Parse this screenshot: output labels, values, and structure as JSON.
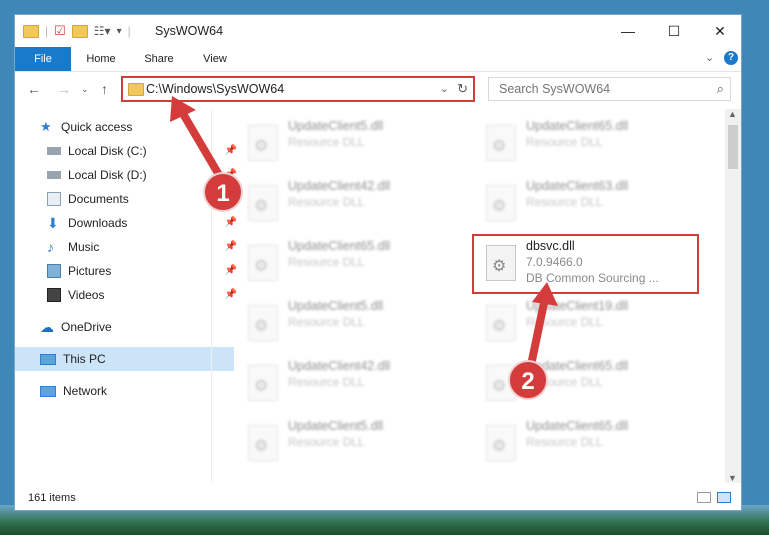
{
  "window": {
    "title": "SysWOW64",
    "controls": {
      "minimize": "—",
      "maximize": "☐",
      "close": "✕"
    }
  },
  "ribbon": {
    "tabs": [
      "File",
      "Home",
      "Share",
      "View"
    ],
    "expand_icon": "chevron-down-icon",
    "help": "?"
  },
  "address": {
    "path": "C:\\Windows\\SysWOW64",
    "search_placeholder": "Search SysWOW64"
  },
  "sidebar": {
    "items": [
      {
        "label": "Quick access",
        "icon": "star-icon",
        "pinned": false
      },
      {
        "label": "Local Disk (C:)",
        "icon": "drive-icon",
        "pinned": true
      },
      {
        "label": "Local Disk (D:)",
        "icon": "drive-icon",
        "pinned": true
      },
      {
        "label": "Documents",
        "icon": "documents-icon",
        "pinned": true
      },
      {
        "label": "Downloads",
        "icon": "download-icon",
        "pinned": true
      },
      {
        "label": "Music",
        "icon": "music-icon",
        "pinned": true
      },
      {
        "label": "Pictures",
        "icon": "pictures-icon",
        "pinned": true
      },
      {
        "label": "Videos",
        "icon": "videos-icon",
        "pinned": true
      },
      {
        "label": "OneDrive",
        "icon": "cloud-icon",
        "pinned": false
      },
      {
        "label": "This PC",
        "icon": "computer-icon",
        "pinned": false,
        "selected": true
      },
      {
        "label": "Network",
        "icon": "network-icon",
        "pinned": false
      }
    ]
  },
  "files": [
    {
      "name": "UpdateClient5.dll",
      "desc": "Resource DLL"
    },
    {
      "name": "UpdateClient65.dll",
      "desc": "Resource DLL"
    },
    {
      "name": "UpdateClient42.dll",
      "desc": "Resource DLL"
    },
    {
      "name": "UpdateClient63.dll",
      "desc": "Resource DLL"
    },
    {
      "name": "UpdateClient65.dll",
      "desc": "Resource DLL"
    },
    {
      "name": "dbsvc.dll",
      "version": "7.0.9466.0",
      "desc": "DB Common Sourcing ...",
      "highlighted": true
    },
    {
      "name": "UpdateClient5.dll",
      "desc": "Resource DLL"
    },
    {
      "name": "UpdateClient19.dll",
      "desc": "Resource DLL"
    },
    {
      "name": "UpdateClient42.dll",
      "desc": "Resource DLL"
    },
    {
      "name": "UpdateClient65.dll",
      "desc": "Resource DLL"
    },
    {
      "name": "UpdateClient5.dll",
      "desc": "Resource DLL"
    },
    {
      "name": "UpdateClient65.dll",
      "desc": "Resource DLL"
    }
  ],
  "status": {
    "item_count": "161 items"
  },
  "callouts": [
    "1",
    "2"
  ],
  "colors": {
    "accent": "#1979ca",
    "highlight": "#d43b3b",
    "selected": "#cce4f7"
  }
}
